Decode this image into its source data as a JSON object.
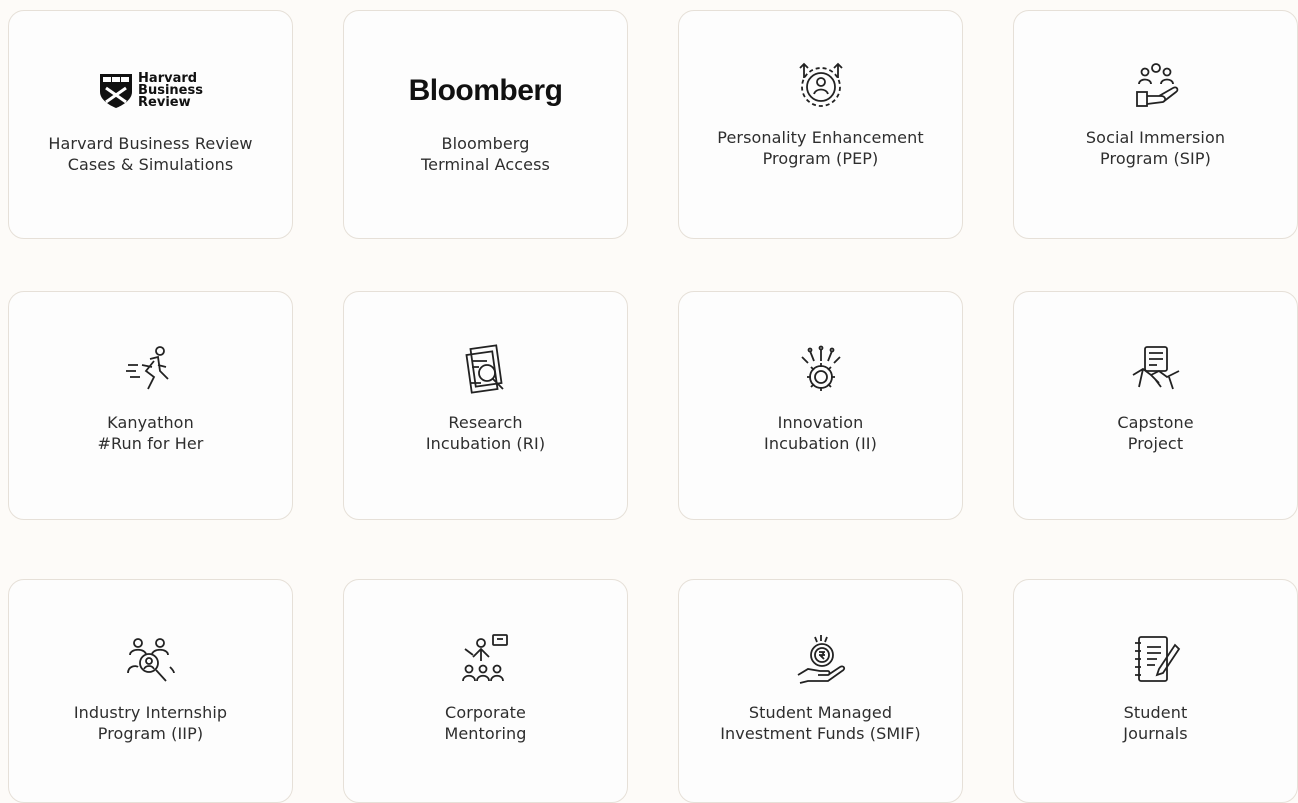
{
  "cards": [
    {
      "logo_text": [
        "Harvard",
        "Business",
        "Review"
      ],
      "icon": "harvard-shield-logo",
      "lines": [
        "Harvard Business Review",
        "Cases & Simulations"
      ]
    },
    {
      "logo_text": [
        "Bloomberg"
      ],
      "icon": "bloomberg-logo",
      "lines": [
        "Bloomberg",
        "Terminal Access"
      ]
    },
    {
      "icon": "personality-growth-icon",
      "lines": [
        "Personality Enhancement",
        "Program (PEP)"
      ]
    },
    {
      "icon": "social-community-icon",
      "lines": [
        "Social Immersion",
        "Program (SIP)"
      ]
    },
    {
      "icon": "runner-icon",
      "lines": [
        "Kanyathon",
        "#Run for Her"
      ]
    },
    {
      "icon": "research-document-icon",
      "lines": [
        "Research",
        "Incubation (RI)"
      ]
    },
    {
      "icon": "innovation-gear-icon",
      "lines": [
        "Innovation",
        "Incubation (II)"
      ]
    },
    {
      "icon": "handshake-icon",
      "lines": [
        "Capstone",
        "Project"
      ]
    },
    {
      "icon": "team-search-icon",
      "lines": [
        "Industry Internship",
        "Program (IIP)"
      ]
    },
    {
      "icon": "mentor-presentation-icon",
      "lines": [
        "Corporate",
        "Mentoring"
      ]
    },
    {
      "icon": "coin-hand-icon",
      "lines": [
        "Student Managed",
        "Investment Funds (SMIF)"
      ]
    },
    {
      "icon": "journal-pen-icon",
      "lines": [
        "Student",
        "Journals"
      ]
    }
  ]
}
